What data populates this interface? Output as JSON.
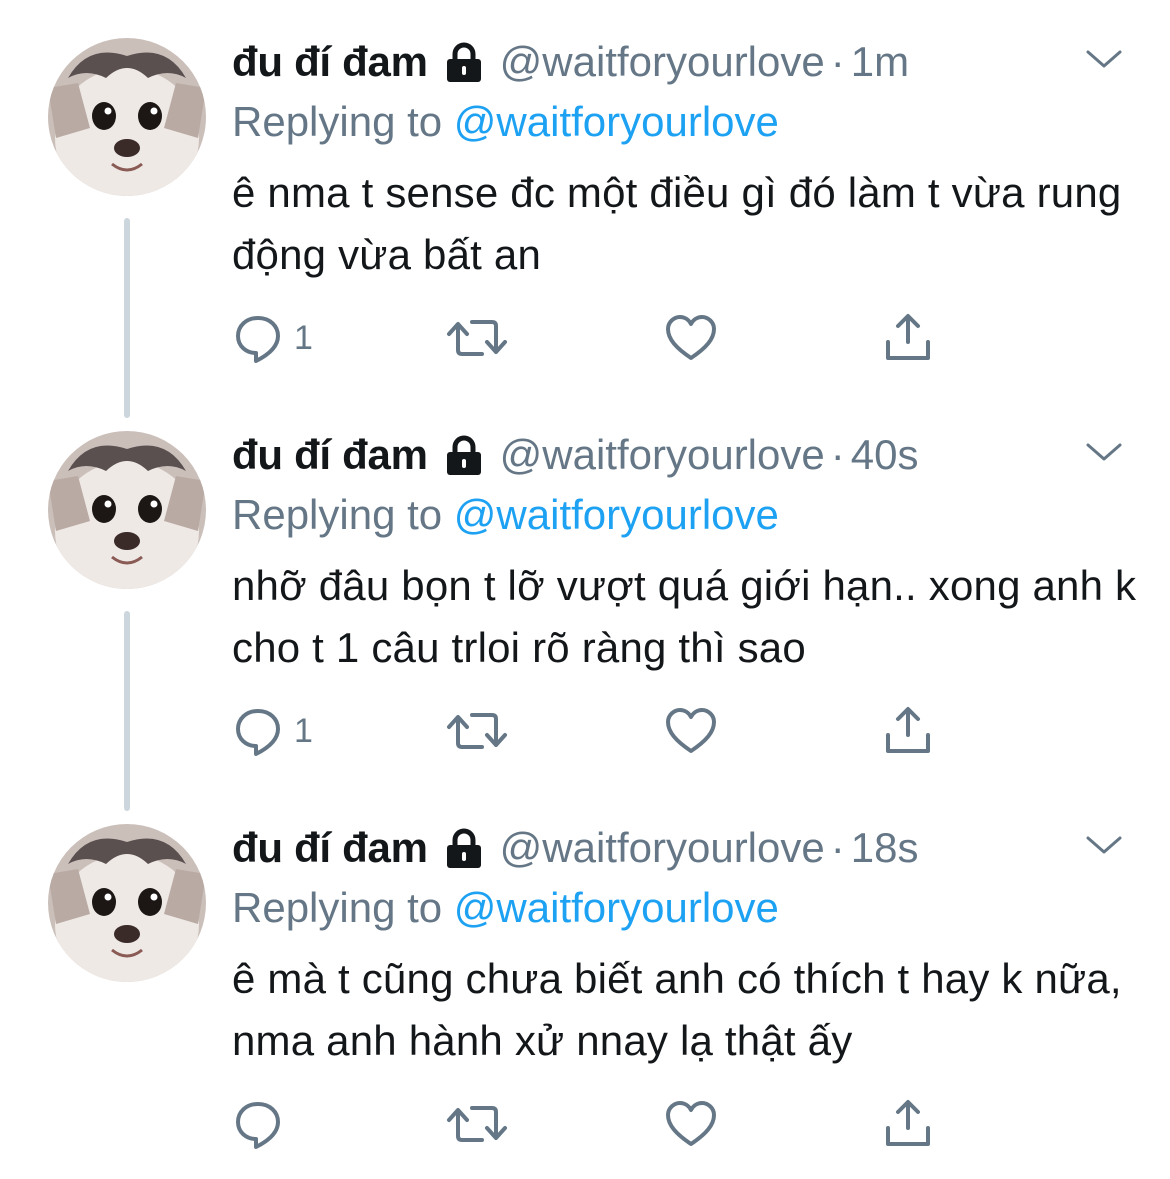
{
  "tweets": [
    {
      "display_name": "đu đí đam",
      "handle": "@waitforyourlove",
      "dot": "·",
      "time": "1m",
      "reply_prefix": "Replying to",
      "reply_to": "@waitforyourlove",
      "text": "ê nma t sense đc một điều gì đó làm t vừa rung động vừa bất an",
      "reply_count": "1",
      "thread_line": true
    },
    {
      "display_name": "đu đí đam",
      "handle": "@waitforyourlove",
      "dot": "·",
      "time": "40s",
      "reply_prefix": "Replying to",
      "reply_to": "@waitforyourlove",
      "text": "nhỡ đâu bọn t lỡ vượt quá giới hạn.. xong anh k cho t 1 câu trloi rõ ràng thì sao",
      "reply_count": "1",
      "thread_line": true
    },
    {
      "display_name": "đu đí đam",
      "handle": "@waitforyourlove",
      "dot": "·",
      "time": "18s",
      "reply_prefix": "Replying to",
      "reply_to": "@waitforyourlove",
      "text": "ê mà t cũng chưa biết anh có thích t hay k nữa, nma anh hành xử nnay lạ thật ấy",
      "reply_count": "",
      "thread_line": false
    }
  ],
  "icons": {
    "lock": "lock-icon",
    "caret": "chevron-down-icon",
    "reply": "reply-icon",
    "retweet": "retweet-icon",
    "like": "heart-icon",
    "share": "share-icon"
  },
  "colors": {
    "text": "#14171a",
    "secondary": "#657786",
    "link": "#1da1f2",
    "thread_line": "#ccd6dd"
  }
}
